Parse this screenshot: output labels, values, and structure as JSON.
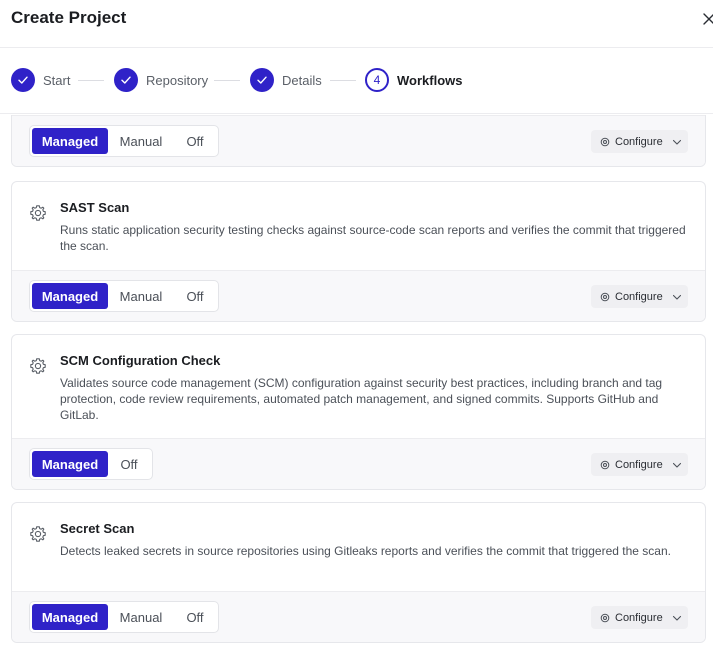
{
  "dialog": {
    "title": "Create Project"
  },
  "steps": [
    {
      "label": "Start",
      "state": "done"
    },
    {
      "label": "Repository",
      "state": "done"
    },
    {
      "label": "Details",
      "state": "done"
    },
    {
      "label": "Workflows",
      "state": "current",
      "number": "4"
    }
  ],
  "colors": {
    "accent": "#2f22c8",
    "foot_bg": "#f8f8fa",
    "border": "#e6e7eb"
  },
  "cards": [
    {
      "title": "",
      "description": "",
      "options": [
        "Managed",
        "Manual",
        "Off"
      ],
      "selected": "Managed",
      "configure_label": "Configure"
    },
    {
      "title": "SAST Scan",
      "description": "Runs static application security testing checks against source-code scan reports and verifies the commit that triggered the scan.",
      "options": [
        "Managed",
        "Manual",
        "Off"
      ],
      "selected": "Managed",
      "configure_label": "Configure"
    },
    {
      "title": "SCM Configuration Check",
      "description": "Validates source code management (SCM) configuration against security best practices, including branch and tag protection, code review requirements, automated patch management, and signed commits. Supports GitHub and GitLab.",
      "options": [
        "Managed",
        "Off"
      ],
      "selected": "Managed",
      "configure_label": "Configure"
    },
    {
      "title": "Secret Scan",
      "description": "Detects leaked secrets in source repositories using Gitleaks reports and verifies the commit that triggered the scan.",
      "options": [
        "Managed",
        "Manual",
        "Off"
      ],
      "selected": "Managed",
      "configure_label": "Configure"
    }
  ],
  "icons": {
    "close": "close-icon",
    "step_done": "check-icon",
    "workflow": "gear-icon",
    "configure": "settings-icon",
    "dropdown": "chevron-down-icon"
  }
}
